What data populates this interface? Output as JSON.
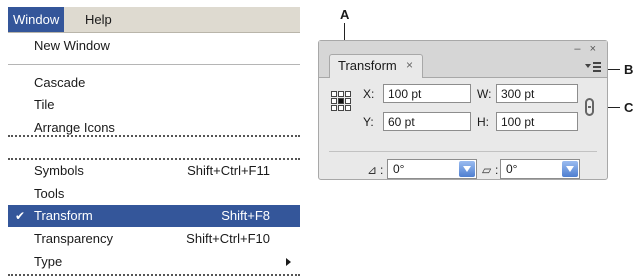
{
  "menubar": {
    "items": [
      "Window",
      "Help"
    ],
    "active": "Window"
  },
  "menu": {
    "items": [
      {
        "label": "New Window",
        "shortcut": ""
      },
      {
        "label": "Cascade",
        "shortcut": ""
      },
      {
        "label": "Tile",
        "shortcut": ""
      },
      {
        "label": "Arrange Icons",
        "shortcut": ""
      },
      {
        "label": "Symbols",
        "shortcut": "Shift+Ctrl+F11"
      },
      {
        "label": "Tools",
        "shortcut": ""
      },
      {
        "label": "Transform",
        "shortcut": "Shift+F8",
        "checked": true,
        "selected": true
      },
      {
        "label": "Transparency",
        "shortcut": "Shift+Ctrl+F10"
      },
      {
        "label": "Type",
        "shortcut": "",
        "submenu": true
      }
    ]
  },
  "callouts": {
    "a": "A",
    "b": "B",
    "c": "C"
  },
  "panel": {
    "tab_title": "Transform",
    "tab_close": "×",
    "window_controls": "– ×",
    "fields": {
      "x_label": "X:",
      "x_value": "100 pt",
      "y_label": "Y:",
      "y_value": "60 pt",
      "w_label": "W:",
      "w_value": "300 pt",
      "h_label": "H:",
      "h_value": "100 pt"
    },
    "rotate": {
      "label": ":",
      "value": "0°"
    },
    "shear": {
      "label": ":",
      "value": "0°"
    }
  }
}
